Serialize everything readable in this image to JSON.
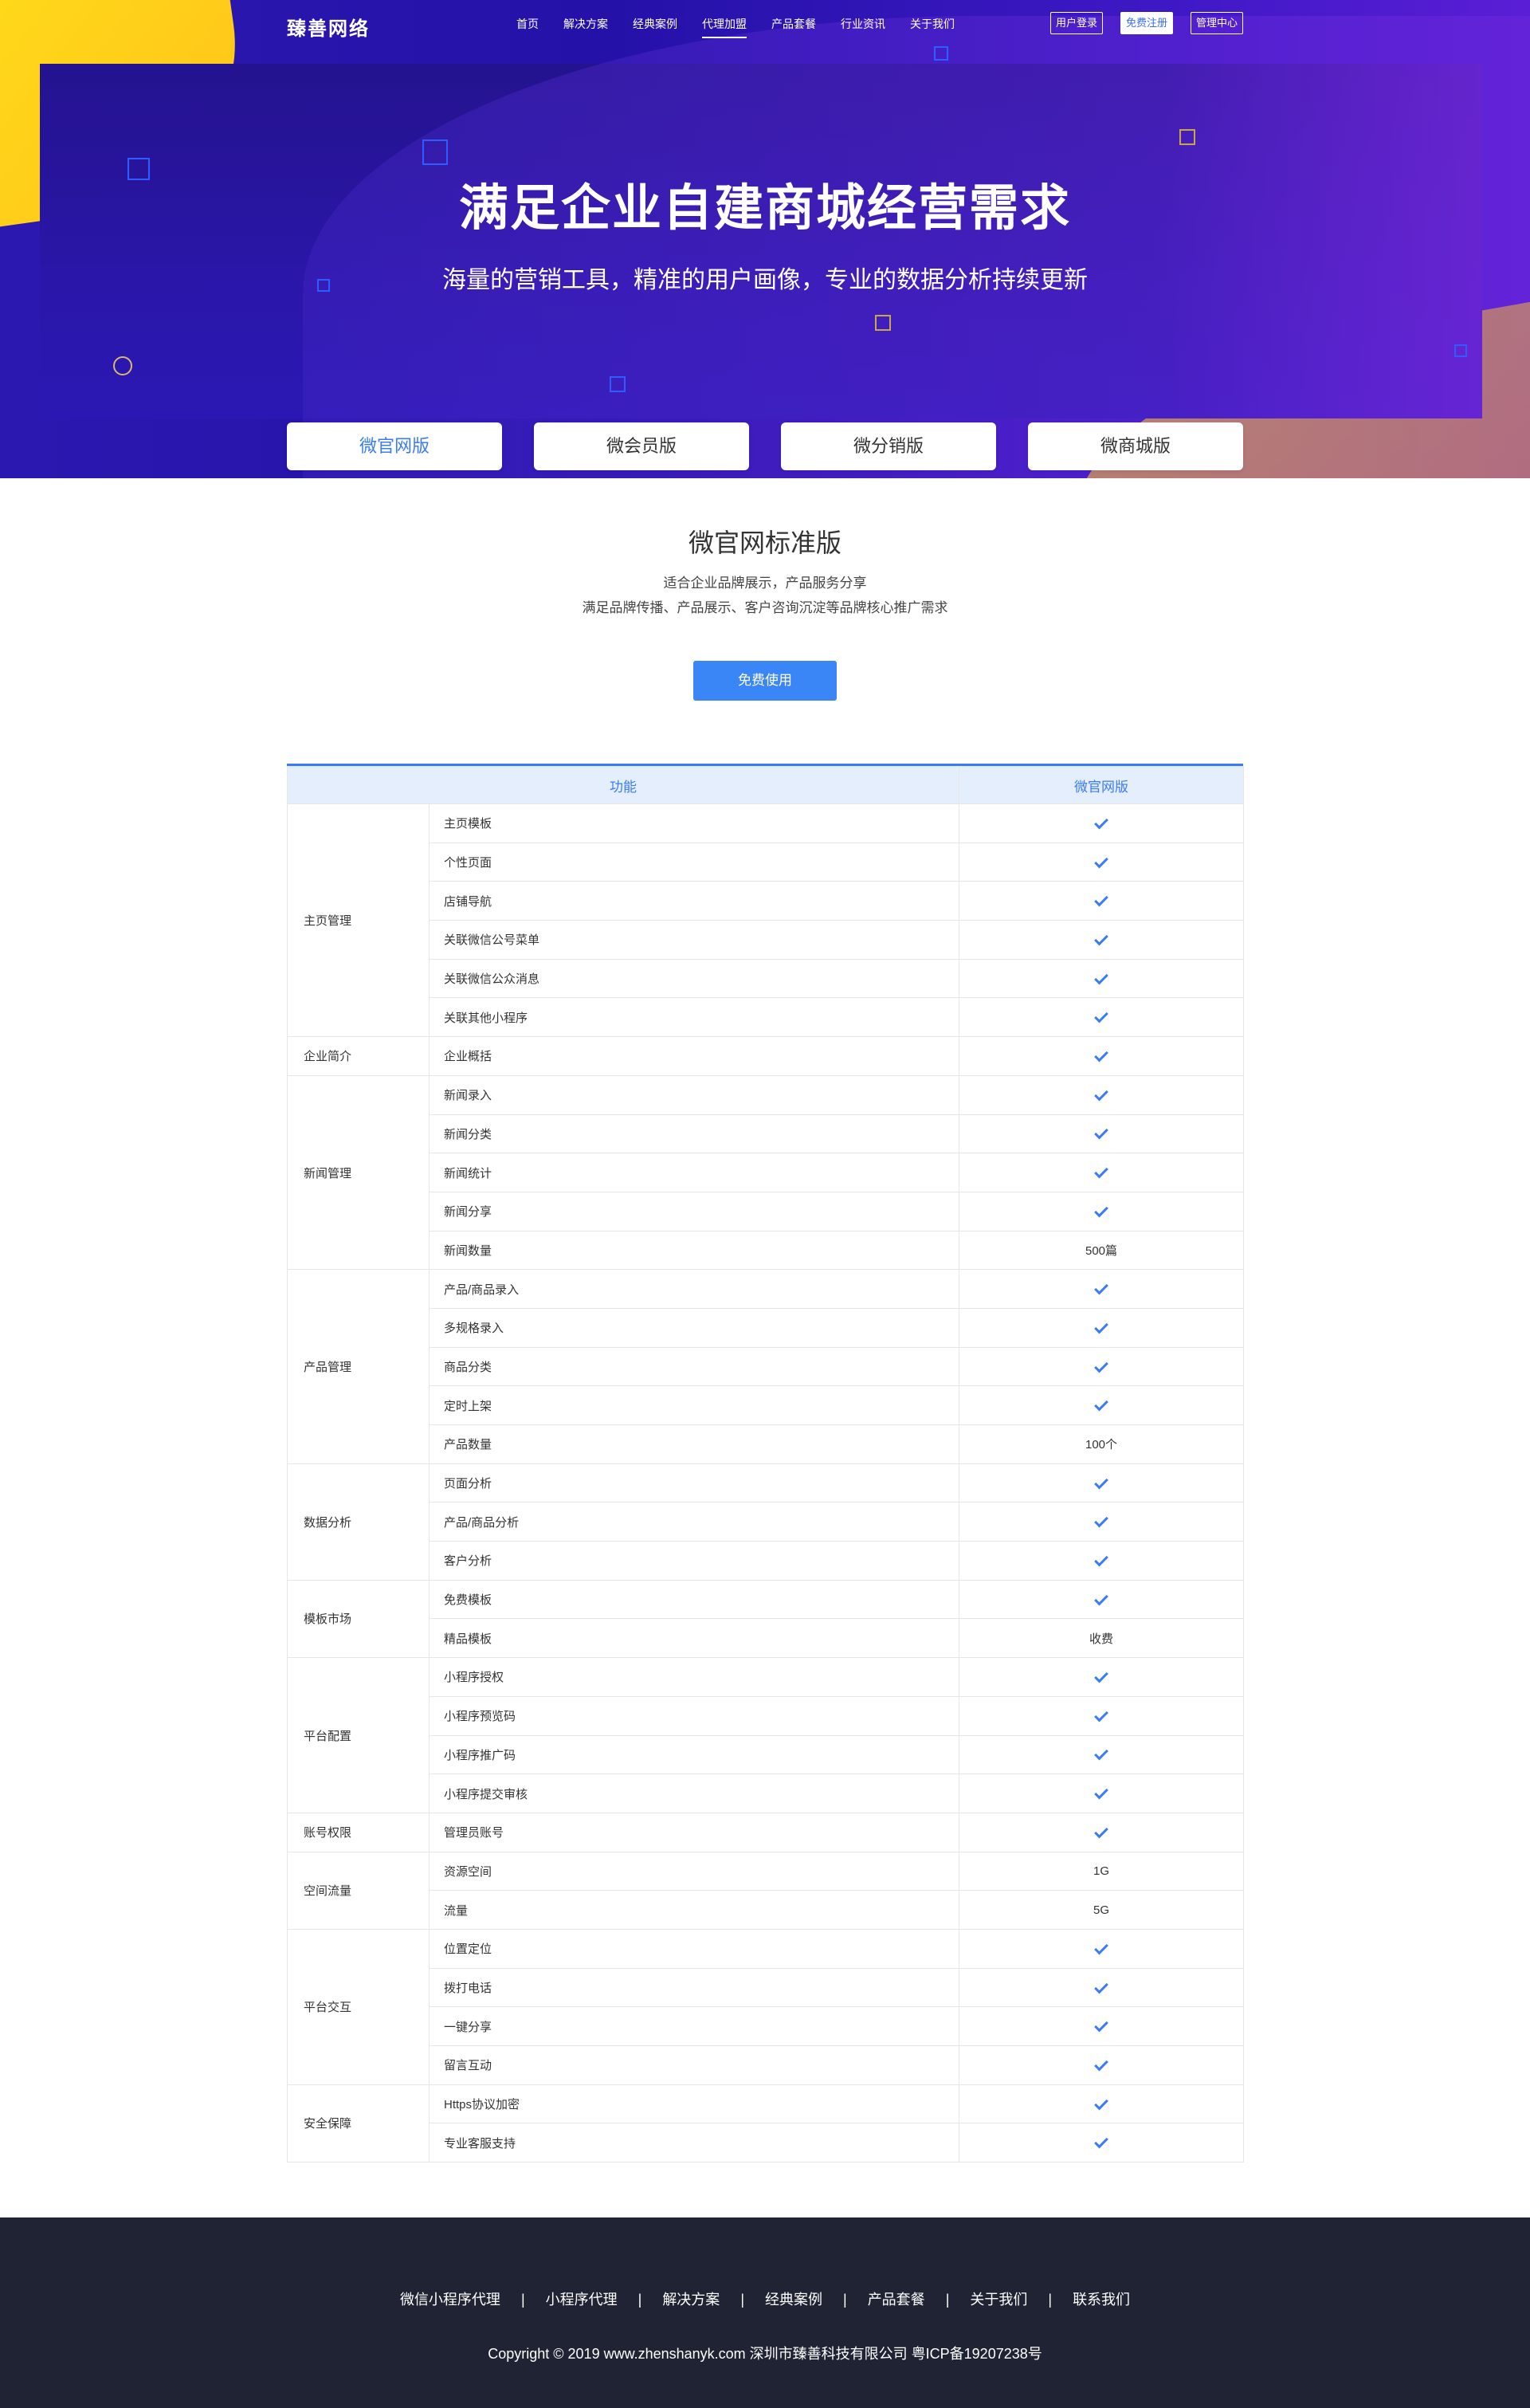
{
  "nav": {
    "logo": "臻善网络",
    "menu": [
      {
        "label": "首页"
      },
      {
        "label": "解决方案"
      },
      {
        "label": "经典案例"
      },
      {
        "label": "代理加盟",
        "active": true
      },
      {
        "label": "产品套餐"
      },
      {
        "label": "行业资讯"
      },
      {
        "label": "关于我们"
      }
    ],
    "login_label": "用户登录",
    "register_label": "免费注册",
    "admin_label": "管理中心"
  },
  "hero": {
    "title": "满足企业自建商城经营需求",
    "subtitle": "海量的营销工具，精准的用户画像，专业的数据分析持续更新"
  },
  "tabs": [
    {
      "label": "微官网版",
      "active": true
    },
    {
      "label": "微会员版"
    },
    {
      "label": "微分销版"
    },
    {
      "label": "微商城版"
    }
  ],
  "intro": {
    "title": "微官网标准版",
    "desc_line1": "适合企业品牌展示，产品服务分享",
    "desc_line2": "满足品牌传播、产品展示、客户咨询沉淀等品牌核心推广需求",
    "cta_label": "免费使用"
  },
  "table": {
    "header_feature": "功能",
    "header_version": "微官网版",
    "groups": [
      {
        "name": "主页管理",
        "rows": [
          {
            "feature": "主页模板",
            "value": "check"
          },
          {
            "feature": "个性页面",
            "value": "check"
          },
          {
            "feature": "店铺导航",
            "value": "check"
          },
          {
            "feature": "关联微信公号菜单",
            "value": "check"
          },
          {
            "feature": "关联微信公众消息",
            "value": "check"
          },
          {
            "feature": "关联其他小程序",
            "value": "check"
          }
        ]
      },
      {
        "name": "企业简介",
        "rows": [
          {
            "feature": "企业概括",
            "value": "check"
          }
        ]
      },
      {
        "name": "新闻管理",
        "rows": [
          {
            "feature": "新闻录入",
            "value": "check"
          },
          {
            "feature": "新闻分类",
            "value": "check"
          },
          {
            "feature": "新闻统计",
            "value": "check"
          },
          {
            "feature": "新闻分享",
            "value": "check"
          },
          {
            "feature": "新闻数量",
            "value": "500篇"
          }
        ]
      },
      {
        "name": "产品管理",
        "rows": [
          {
            "feature": "产品/商品录入",
            "value": "check"
          },
          {
            "feature": "多规格录入",
            "value": "check"
          },
          {
            "feature": "商品分类",
            "value": "check"
          },
          {
            "feature": "定时上架",
            "value": "check"
          },
          {
            "feature": "产品数量",
            "value": "100个"
          }
        ]
      },
      {
        "name": "数据分析",
        "rows": [
          {
            "feature": "页面分析",
            "value": "check"
          },
          {
            "feature": "产品/商品分析",
            "value": "check"
          },
          {
            "feature": "客户分析",
            "value": "check"
          }
        ]
      },
      {
        "name": "模板市场",
        "rows": [
          {
            "feature": "免费模板",
            "value": "check"
          },
          {
            "feature": "精品模板",
            "value": "收费"
          }
        ]
      },
      {
        "name": "平台配置",
        "rows": [
          {
            "feature": "小程序授权",
            "value": "check"
          },
          {
            "feature": "小程序预览码",
            "value": "check"
          },
          {
            "feature": "小程序推广码",
            "value": "check"
          },
          {
            "feature": "小程序提交审核",
            "value": "check"
          }
        ]
      },
      {
        "name": "账号权限",
        "rows": [
          {
            "feature": "管理员账号",
            "value": "check"
          }
        ]
      },
      {
        "name": "空间流量",
        "rows": [
          {
            "feature": "资源空间",
            "value": "1G"
          },
          {
            "feature": "流量",
            "value": "5G"
          }
        ]
      },
      {
        "name": "平台交互",
        "rows": [
          {
            "feature": "位置定位",
            "value": "check"
          },
          {
            "feature": "拨打电话",
            "value": "check"
          },
          {
            "feature": "一键分享",
            "value": "check"
          },
          {
            "feature": "留言互动",
            "value": "check"
          }
        ]
      },
      {
        "name": "安全保障",
        "rows": [
          {
            "feature": "Https协议加密",
            "value": "check"
          },
          {
            "feature": "专业客服支持",
            "value": "check"
          }
        ]
      }
    ]
  },
  "footer": {
    "links": [
      "微信小程序代理",
      "小程序代理",
      "解决方案",
      "经典案例",
      "产品套餐",
      "关于我们",
      "联系我们"
    ],
    "separator": "|",
    "copyright": "Copyright  ©  2019 www.zhenshanyk.com  深圳市臻善科技有限公司  粤ICP备19207238号"
  },
  "colors": {
    "accent": "#3a7cf5",
    "hero_bg": "#2a18b0",
    "hero_yellow": "#ffc21a",
    "footer_bg": "#1f2333"
  },
  "icons": {
    "check": "checkmark-icon"
  }
}
